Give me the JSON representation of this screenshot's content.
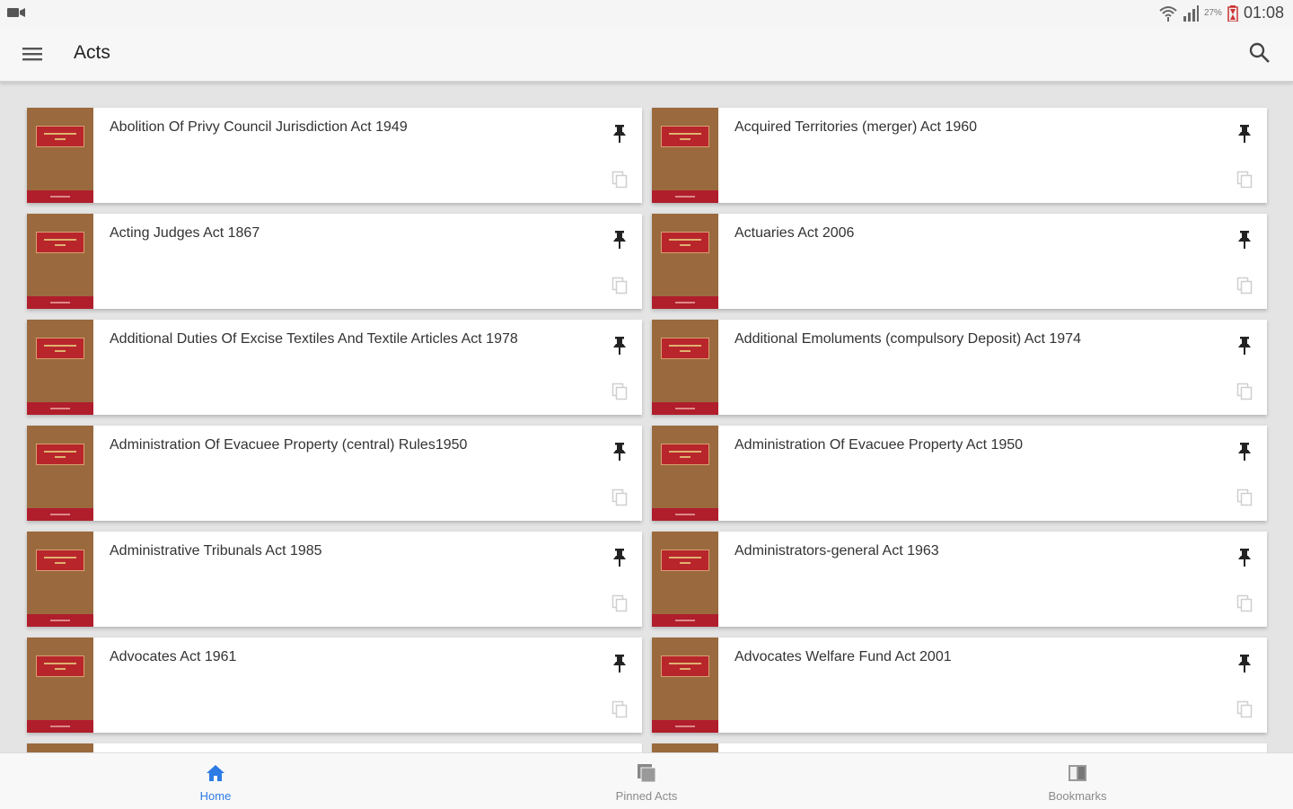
{
  "status_bar": {
    "battery_percent": "27%",
    "time": "01:08"
  },
  "app_bar": {
    "title": "Acts"
  },
  "acts": [
    "Abolition Of Privy Council Jurisdiction Act 1949",
    "Acquired Territories (merger) Act 1960",
    "Acting Judges Act 1867",
    "Actuaries Act 2006",
    "Additional Duties Of Excise Textiles And Textile Articles Act 1978",
    "Additional Emoluments (compulsory Deposit) Act 1974",
    "Administration Of Evacuee Property (central) Rules1950",
    "Administration Of Evacuee Property Act 1950",
    "Administrative Tribunals Act 1985",
    "Administrators-general Act 1963",
    "Advocates Act 1961",
    "Advocates Welfare Fund Act 2001"
  ],
  "bottom_nav": [
    {
      "label": "Home",
      "icon": "home-icon",
      "active": true
    },
    {
      "label": "Pinned Acts",
      "icon": "pinned-acts-icon",
      "active": false
    },
    {
      "label": "Bookmarks",
      "icon": "bookmarks-icon",
      "active": false
    }
  ],
  "colors": {
    "accent": "#2d7be5",
    "book_cover": "#9a6a3e",
    "book_label": "#b8262c"
  }
}
